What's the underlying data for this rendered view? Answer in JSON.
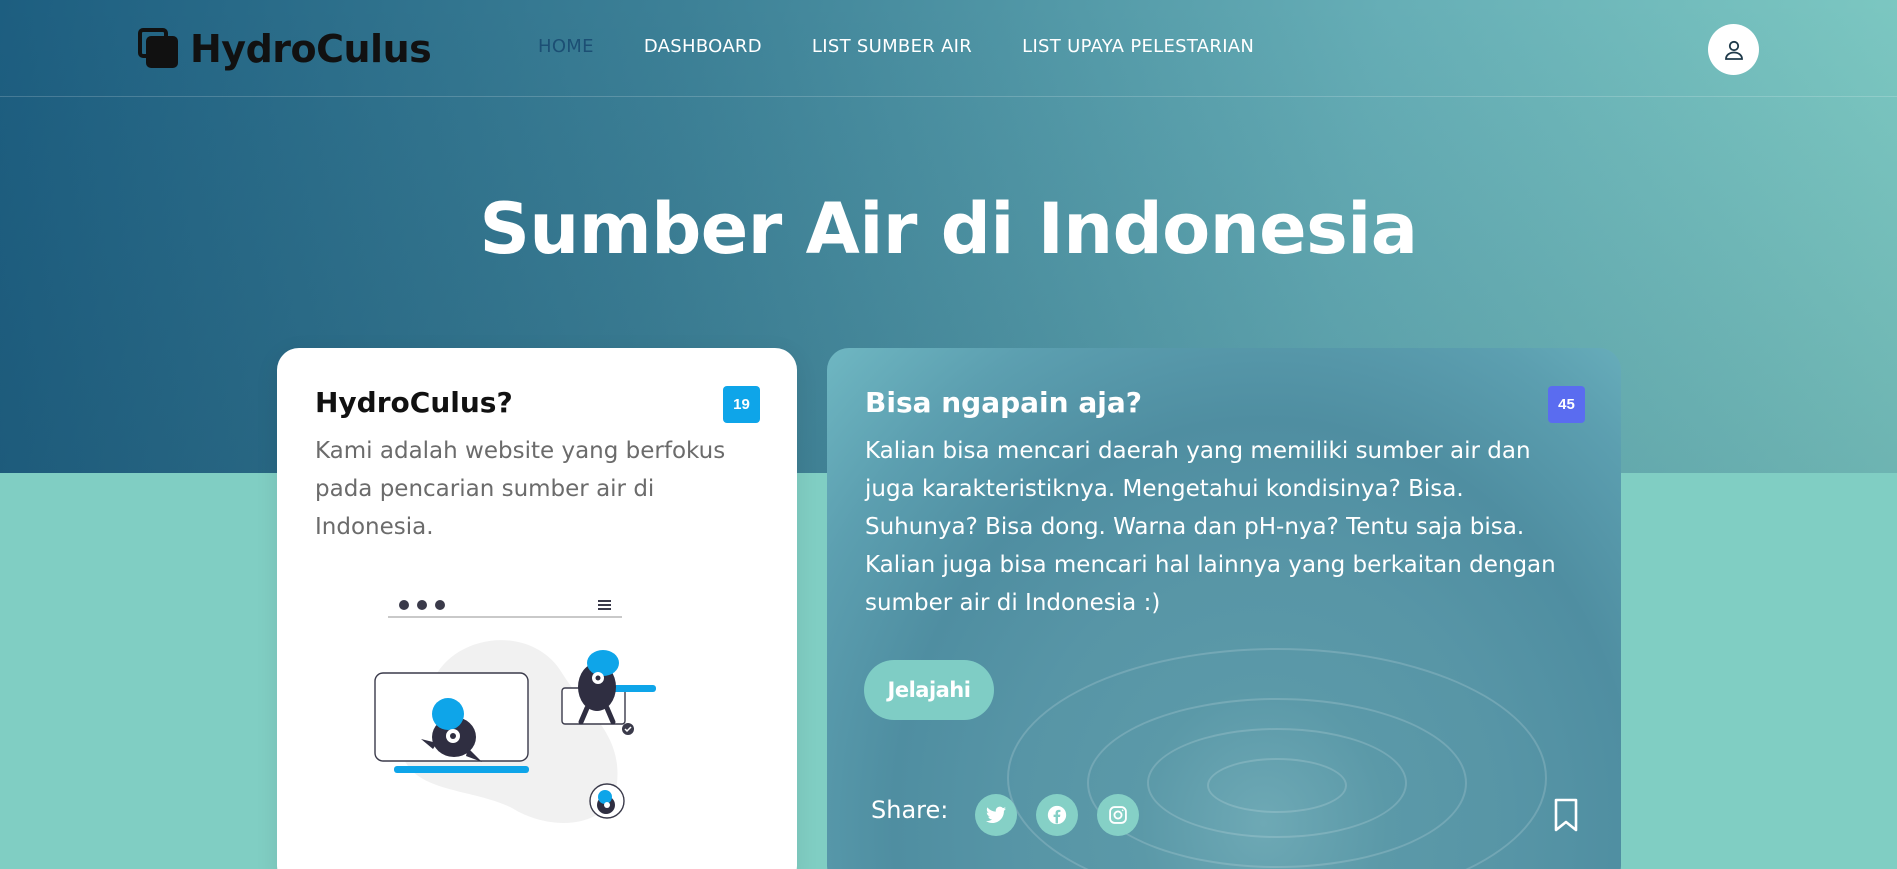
{
  "brand": {
    "name": "HydroCulus"
  },
  "nav": {
    "items": [
      {
        "label": "HOME",
        "active": true
      },
      {
        "label": "DASHBOARD",
        "active": false
      },
      {
        "label": "LIST SUMBER AIR",
        "active": false
      },
      {
        "label": "LIST UPAYA PELESTARIAN",
        "active": false
      }
    ]
  },
  "hero": {
    "title": "Sumber Air di Indonesia"
  },
  "card_about": {
    "title": "HydroCulus?",
    "badge": "19",
    "text": "Kami adalah website yang berfokus pada pencarian sumber air di Indonesia."
  },
  "card_features": {
    "title": "Bisa ngapain aja?",
    "badge": "45",
    "text": "Kalian bisa mencari daerah yang memiliki sumber air dan juga karakteristiknya. Mengetahui kondisinya? Bisa. Suhunya? Bisa dong. Warna dan pH-nya? Tentu saja bisa. Kalian juga bisa mencari hal lainnya yang berkaitan dengan sumber air di Indonesia :)",
    "button": "Jelajahi",
    "share_label": "Share:"
  },
  "icons": {
    "user": "user-icon",
    "twitter": "twitter-icon",
    "facebook": "facebook-icon",
    "instagram": "instagram-icon",
    "bookmark": "bookmark-icon"
  },
  "colors": {
    "accent_blue": "#0ea5e9",
    "badge_indigo": "#5a6cf0",
    "teal": "#80cec3",
    "nav_active": "#1c4f74"
  }
}
